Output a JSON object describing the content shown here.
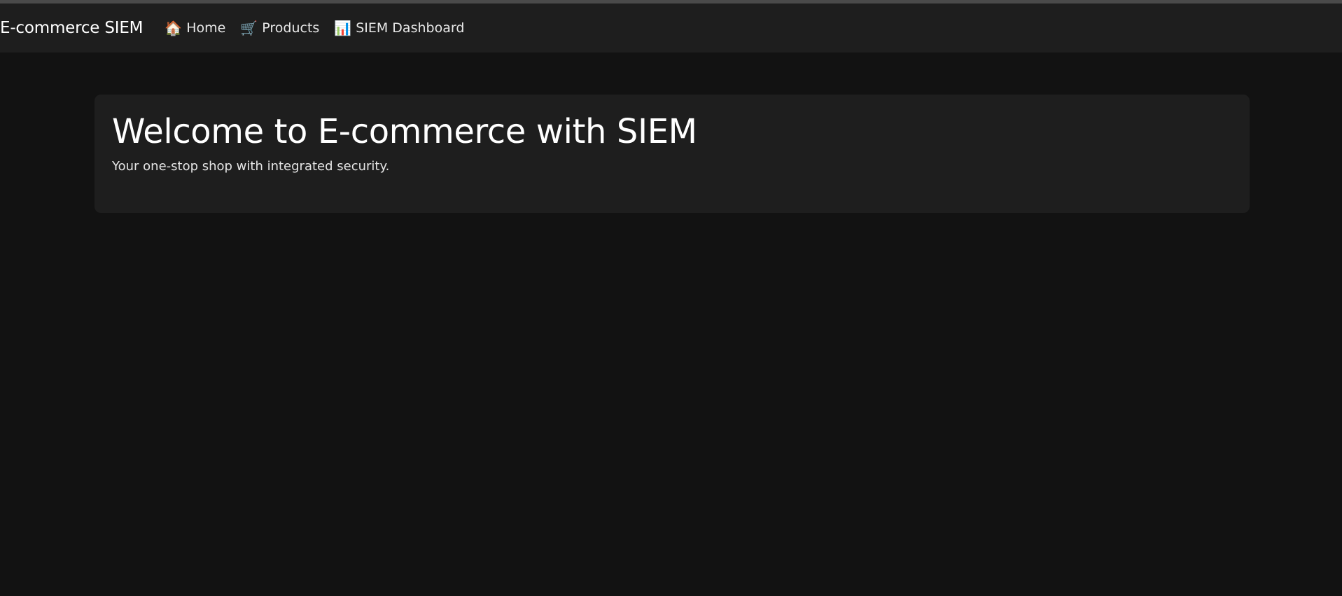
{
  "navbar": {
    "brand": "E-commerce SIEM",
    "links": [
      {
        "label": "Home",
        "icon": "🏠",
        "icon_name": "home-icon"
      },
      {
        "label": "Products",
        "icon": "🛒",
        "icon_name": "cart-icon"
      },
      {
        "label": "SIEM Dashboard",
        "icon": "📊",
        "icon_name": "bar-chart-icon"
      }
    ]
  },
  "hero": {
    "title": "Welcome to E-commerce with SIEM",
    "subtitle": "Your one-stop shop with integrated security."
  },
  "colors": {
    "background": "#121212",
    "surface": "#1e1e1e",
    "text": "#ffffff"
  }
}
